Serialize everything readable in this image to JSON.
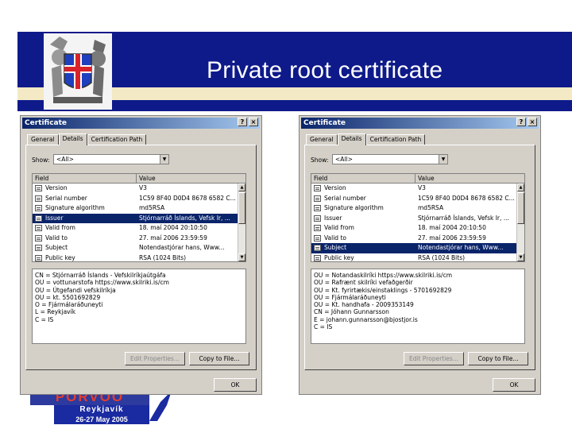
{
  "slide": {
    "title": "Private root certificate",
    "logo": {
      "name": "PORVOO",
      "city": "Reykjavík",
      "dates": "26-27 May 2005"
    }
  },
  "dialogs": [
    {
      "title": "Certificate",
      "help_label": "?",
      "close_label": "×",
      "tabs": [
        "General",
        "Details",
        "Certification Path"
      ],
      "active_tab": "Details",
      "show_label": "Show:",
      "show_value": "<All>",
      "columns": [
        "Field",
        "Value"
      ],
      "rows": [
        {
          "field": "Version",
          "value": "V3"
        },
        {
          "field": "Serial number",
          "value": "1C59 8F40 D0D4 8678 6582 C..."
        },
        {
          "field": "Signature algorithm",
          "value": "md5RSA"
        },
        {
          "field": "Issuer",
          "value": "Stjórnarráð Íslands, Vefsk Ir, ..."
        },
        {
          "field": "Valid from",
          "value": "18. maí 2004 20:10:50"
        },
        {
          "field": "Valid to",
          "value": "27. maí 2006 23:59:59"
        },
        {
          "field": "Subject",
          "value": "Notendastjórar hans, Www..."
        },
        {
          "field": "Public key",
          "value": "RSA (1024 Bits)"
        }
      ],
      "selected_row": 3,
      "details": [
        "CN = Stjórnarráð Íslands - Vefskilríkjaútgáfa",
        "OU = vottunarstofa https://www.skilriki.is/cm",
        "OU = Útgefandi vefskilríkja",
        "OU = kt. 5501692829",
        "O = Fjármálaráðuneyti",
        "L = Reykjavík",
        "C = IS"
      ],
      "edit_label": "Edit Properties...",
      "copy_label": "Copy to File...",
      "ok_label": "OK"
    },
    {
      "title": "Certificate",
      "help_label": "?",
      "close_label": "×",
      "tabs": [
        "General",
        "Details",
        "Certification Path"
      ],
      "active_tab": "Details",
      "show_label": "Show:",
      "show_value": "<All>",
      "columns": [
        "Field",
        "Value"
      ],
      "rows": [
        {
          "field": "Version",
          "value": "V3"
        },
        {
          "field": "Serial number",
          "value": "1C59 8F40 D0D4 8678 6582 C..."
        },
        {
          "field": "Signature algorithm",
          "value": "md5RSA"
        },
        {
          "field": "Issuer",
          "value": "Stjórnarráð Íslands, Vefsk Ir, ..."
        },
        {
          "field": "Valid from",
          "value": "18. maí 2004 20:10:50"
        },
        {
          "field": "Valid to",
          "value": "27. maí 2006 23:59:59"
        },
        {
          "field": "Subject",
          "value": "Notendastjórar hans, Www..."
        },
        {
          "field": "Public key",
          "value": "RSA (1024 Bits)"
        }
      ],
      "selected_row": 6,
      "details": [
        "OU = Notandaskilríki https://www.skilriki.is/cm",
        "OU = Rafrænt skilríki vefaðgerðir",
        "OU = Kt. fyrirtækis/einstaklings - 5701692829",
        "OU = Fjármálaráðuneyti",
        "OU = Kt. handhafa - 2009353149",
        "CN = Jóhann Gunnarsson",
        "E = johann.gunnarsson@bjostjor.is",
        "C = IS"
      ],
      "edit_label": "Edit Properties...",
      "copy_label": "Copy to File...",
      "ok_label": "OK"
    }
  ],
  "colors": {
    "banner": "#0e1a8a",
    "selection": "#0a246a",
    "dialog_bg": "#d4d0c8"
  }
}
